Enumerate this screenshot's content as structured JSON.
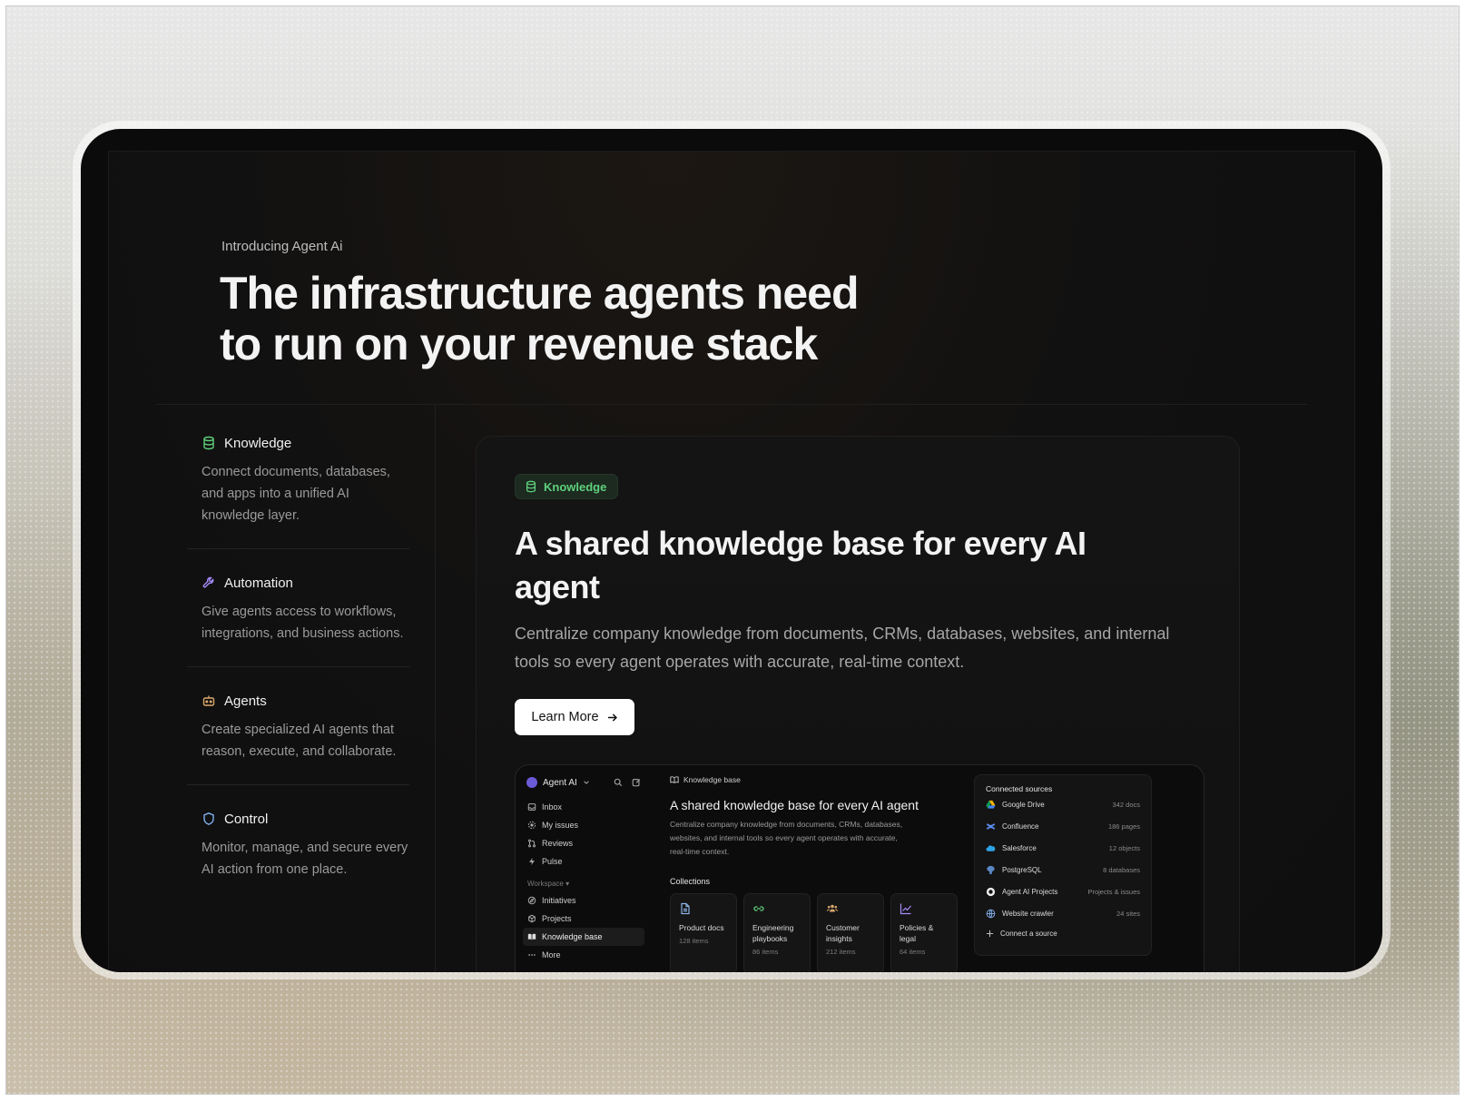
{
  "hero": {
    "eyebrow": "Introducing Agent Ai",
    "title_line1": "The infrastructure agents need",
    "title_line2": "to run on your revenue stack"
  },
  "features": [
    {
      "title": "Knowledge",
      "description": "Connect documents, databases, and apps into a unified AI knowledge layer.",
      "icon": "database-icon"
    },
    {
      "title": "Automation",
      "description": "Give agents access to workflows, integrations, and business actions.",
      "icon": "wrench-icon"
    },
    {
      "title": "Agents",
      "description": "Create specialized AI agents that reason, execute, and collaborate.",
      "icon": "robot-icon"
    },
    {
      "title": "Control",
      "description": "Monitor, manage, and secure every AI action from one place.",
      "icon": "shield-icon"
    }
  ],
  "card": {
    "badge": "Knowledge",
    "title": "A shared knowledge base for every AI agent",
    "description": "Centralize company knowledge from documents, CRMs, databases, websites, and internal tools so every agent operates with accurate, real-time context.",
    "button": "Learn More"
  },
  "app": {
    "workspace_name": "Agent AI",
    "nav": [
      {
        "label": "Inbox"
      },
      {
        "label": "My issues"
      },
      {
        "label": "Reviews"
      },
      {
        "label": "Pulse"
      }
    ],
    "section_label": "Workspace",
    "workspace_nav": [
      {
        "label": "Initiatives"
      },
      {
        "label": "Projects"
      },
      {
        "label": "Knowledge base"
      },
      {
        "label": "More"
      }
    ],
    "breadcrumb": "Knowledge base",
    "heading": "A shared knowledge base for every AI agent",
    "paragraph": "Centralize company knowledge from documents, CRMs, databases, websites, and internal tools so every agent operates with accurate, real-time context.",
    "collections_label": "Collections",
    "collections": [
      {
        "name": "Product docs",
        "count": "128 items"
      },
      {
        "name": "Engineering playbooks",
        "count": "86 items"
      },
      {
        "name": "Customer insights",
        "count": "212 items"
      },
      {
        "name": "Policies & legal",
        "count": "64 items"
      }
    ],
    "sources_title": "Connected sources",
    "sources": [
      {
        "name": "Google Drive",
        "meta": "342 docs"
      },
      {
        "name": "Confluence",
        "meta": "186 pages"
      },
      {
        "name": "Salesforce",
        "meta": "12 objects"
      },
      {
        "name": "PostgreSQL",
        "meta": "8 databases"
      },
      {
        "name": "Agent AI Projects",
        "meta": "Projects & issues"
      },
      {
        "name": "Website crawler",
        "meta": "24 sites"
      }
    ],
    "connect_label": "Connect a source"
  },
  "colors": {
    "accent_green": "#5fd07c",
    "accent_purple": "#a78bfa",
    "background": "#0f0f0f"
  }
}
